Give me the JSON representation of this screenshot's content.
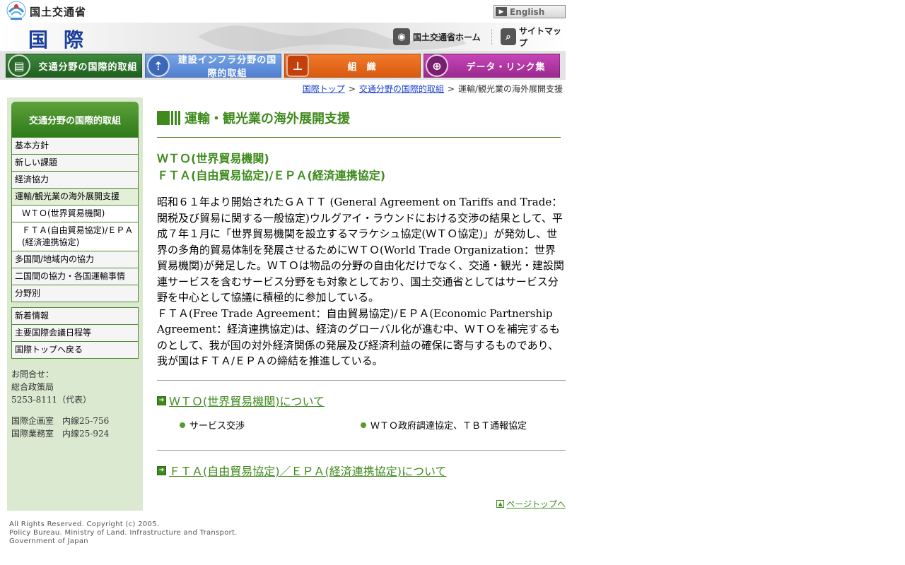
{
  "header": {
    "logo_text": "国土交通省",
    "english_label": "English",
    "section_title": "国際",
    "home_link": "国土交通省ホーム",
    "sitemap_link": "サイトマップ"
  },
  "nav": {
    "tabs": [
      {
        "label": "交通分野の国際的取組"
      },
      {
        "label": "建設インフラ分野の国際的取組"
      },
      {
        "label": "組織"
      },
      {
        "label": "データ・リンク集"
      }
    ]
  },
  "breadcrumb": {
    "items": [
      "国際トップ",
      "交通分野の国際的取組",
      "運輸/観光業の海外展開支援"
    ],
    "separator": ">"
  },
  "sidebar": {
    "header": "交通分野の国際的取組",
    "menu": [
      {
        "label": "基本方針"
      },
      {
        "label": "新しい課題"
      },
      {
        "label": "経済協力"
      },
      {
        "label": "運輸/観光業の海外展開支援"
      },
      {
        "label": "ＷＴＯ(世界貿易機関)"
      },
      {
        "label": "ＦＴＡ(自由貿易協定)/ＥＰＡ(経済連携協定)"
      },
      {
        "label": "多国間/地域内の協力"
      },
      {
        "label": "二国間の協力・各国運輸事情"
      },
      {
        "label": "分野別"
      }
    ],
    "menu2": [
      {
        "label": "新着情報"
      },
      {
        "label": "主要国際会議日程等"
      },
      {
        "label": "国際トップへ戻る"
      }
    ],
    "contact": {
      "label": "お問合せ：",
      "dept": "総合政策局",
      "phone": "5253-8111（代表）",
      "office1": "国際企画室　内線25-756",
      "office2": "国際業務室　内線25-924"
    }
  },
  "main": {
    "title": "運輸・観光業の海外展開支援",
    "subhead_line1": "ＷＴＯ(世界貿易機関)",
    "subhead_line2": "ＦＴＡ(自由貿易協定)/ＥＰＡ(経済連携協定)",
    "intro_p1": "昭和６１年より開始されたＧＡＴＴ (General Agreement on Tariffs and Trade：関税及び貿易に関する一般協定)ウルグアイ・ラウンドにおける交渉の結果として、平成７年１月に「世界貿易機関を設立するマラケシュ協定(ＷＴＯ協定)」が発効し、世界の多角的貿易体制を発展させるためにＷＴＯ(World Trade Organization：世界貿易機関)が発足した。ＷＴＯは物品の分野の自由化だけでなく、交通・観光・建設関連サービスを含むサービス分野をも対象としており、国土交通省としてはサービス分野を中心として協議に積極的に参加している。",
    "intro_p2": "ＦＴＡ(Free Trade Agreement：自由貿易協定)/ＥＰＡ(Economic Partnership Agreement：経済連携協定)は、経済のグローバル化が進む中、ＷＴＯを補完するものとして、我が国の対外経済関係の発展及び経済利益の確保に寄与するものであり、我が国はＦＴＡ/ＥＰＡの締結を推進している。",
    "wto_link": "ＷＴＯ(世界貿易機関)について",
    "wto_items": [
      "サービス交渉",
      "ＷＴＯ政府調達協定、ＴＢＴ通報協定"
    ],
    "fta_link": "ＦＴＡ(自由貿易協定)／ＥＰＡ(経済連携協定)について",
    "page_top": "ページトップへ"
  },
  "footer": {
    "line1": "All Rights Reserved. Copyright (c) 2005.",
    "line2": "Policy Bureau. Ministry of Land. Infrastructure and Transport.",
    "line3": "Government of Japan"
  },
  "colors": {
    "accent_green": "#3e8a1c",
    "sidebar_bg": "#dbe9d1",
    "section_blue": "#1a3f9a",
    "link_blue": "#1a3fcc"
  },
  "icons": {
    "logo": "mlit-logo-icon",
    "english": "arrow-right-icon",
    "home": "mlit-home-icon",
    "sitemap": "magnifier-icon",
    "transport": "train-icon",
    "infra": "road-icon",
    "org": "org-chart-icon",
    "data": "globe-icon",
    "section_link": "arrow-right-icon",
    "bullet": "bullet-dot-icon",
    "page_top": "arrow-up-icon"
  }
}
